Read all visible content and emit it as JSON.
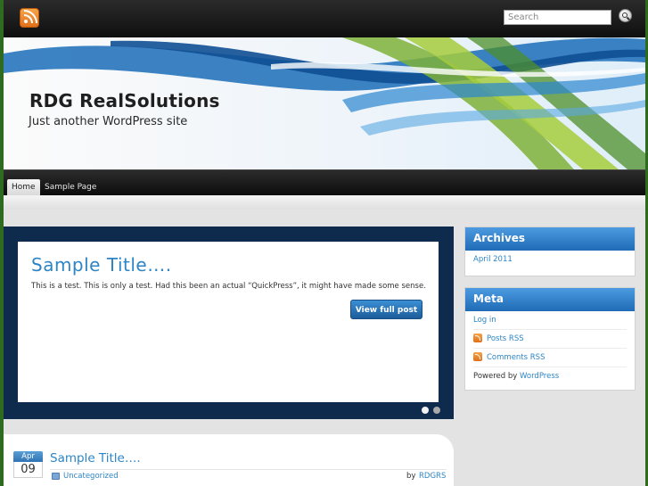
{
  "topbar": {
    "rss_icon": "rss-feed-icon",
    "search": {
      "placeholder": "Search",
      "icon": "search-icon"
    }
  },
  "header": {
    "site_title": "RDG RealSolutions",
    "tagline": "Just another WordPress site"
  },
  "nav": {
    "items": [
      {
        "label": "Home",
        "active": true
      },
      {
        "label": "Sample Page",
        "active": false
      }
    ]
  },
  "slider": {
    "slide_title": "Sample Title….",
    "slide_text": "This is a test. This is only a test. Had this been an actual “QuickPress”, it might have made some sense.",
    "button_label": "View full post",
    "active_dot": 1,
    "dot_count": 2
  },
  "post": {
    "date_month": "Apr",
    "date_day": "09",
    "title": "Sample Title….",
    "category": "Uncategorized",
    "by_label": "by",
    "author": "RDGRS"
  },
  "sidebar": {
    "archives": {
      "title": "Archives",
      "items": [
        "April 2011"
      ]
    },
    "meta": {
      "title": "Meta",
      "items": [
        "Log in",
        "Posts RSS",
        "Comments RSS"
      ],
      "powered_prefix": "Powered by ",
      "powered_link": "WordPress"
    }
  },
  "colors": {
    "accent_blue": "#2d85c5",
    "slider_bg": "#0e2a4d",
    "frame_green": "#2e6b1f"
  }
}
